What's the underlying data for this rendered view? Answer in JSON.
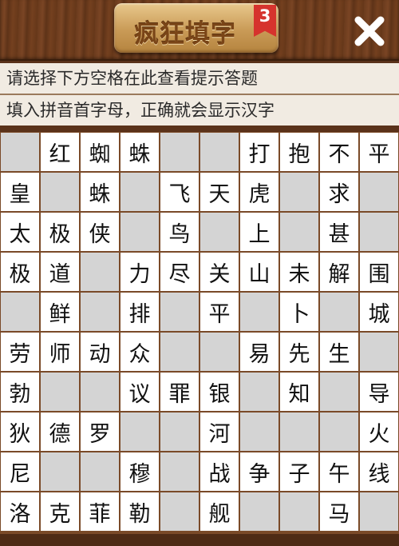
{
  "header": {
    "title": "疯狂填字",
    "level_badge": "3",
    "close_icon": "close-icon"
  },
  "hints": {
    "line1": "请选择下方空格在此查看提示答题",
    "line2": "填入拼音首字母，正确就会显示汉字"
  },
  "colors": {
    "board_border": "#7a4a28",
    "empty_cell": "#d4d4d4",
    "filled_cell": "#ffffff",
    "badge": "#d6332d"
  },
  "board": {
    "rows": [
      [
        "",
        "红",
        "蜘",
        "蛛",
        "",
        "",
        "打",
        "抱",
        "不",
        "平"
      ],
      [
        "皇",
        "",
        "蛛",
        "",
        "飞",
        "天",
        "虎",
        "",
        "求",
        ""
      ],
      [
        "太",
        "极",
        "侠",
        "",
        "鸟",
        "",
        "上",
        "",
        "甚",
        ""
      ],
      [
        "极",
        "道",
        "",
        "力",
        "尽",
        "关",
        "山",
        "未",
        "解",
        "围"
      ],
      [
        "",
        "鲜",
        "",
        "排",
        "",
        "平",
        "",
        "卜",
        "",
        "城"
      ],
      [
        "劳",
        "师",
        "动",
        "众",
        "",
        "",
        "易",
        "先",
        "生",
        ""
      ],
      [
        "勃",
        "",
        "",
        "议",
        "罪",
        "银",
        "",
        "知",
        "",
        "导"
      ],
      [
        "狄",
        "德",
        "罗",
        "",
        "",
        "河",
        "",
        "",
        "",
        "火"
      ],
      [
        "尼",
        "",
        "",
        "穆",
        "",
        "战",
        "争",
        "子",
        "午",
        "线"
      ],
      [
        "洛",
        "克",
        "菲",
        "勒",
        "",
        "舰",
        "",
        "",
        "马",
        ""
      ]
    ]
  }
}
